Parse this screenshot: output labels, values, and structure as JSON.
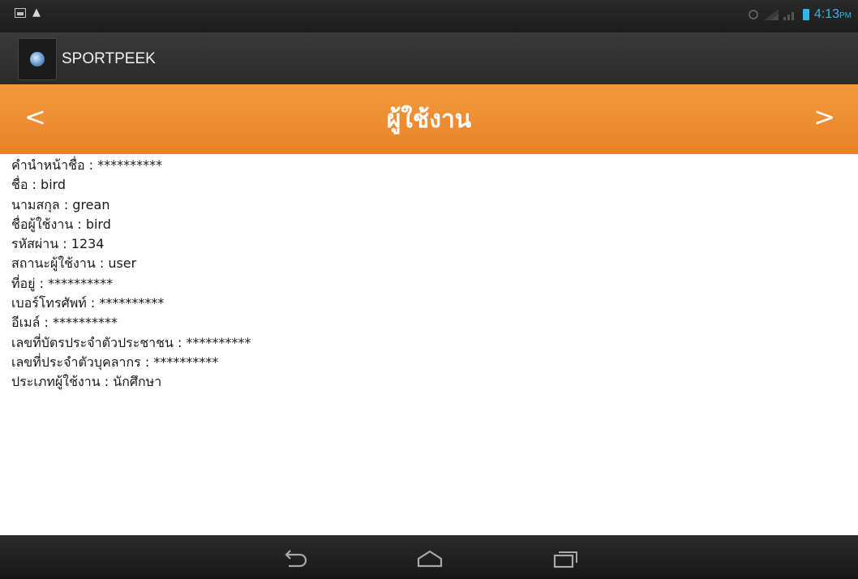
{
  "status_bar": {
    "time": "4:13",
    "ampm": "PM",
    "icons": [
      "picture-icon",
      "warning-icon",
      "alarm-icon",
      "signal-icon",
      "battery-icon"
    ]
  },
  "action_bar": {
    "app_name": "SPORTPEEK",
    "logo": "app-logo-icon"
  },
  "header": {
    "title": "ผู้ใช้งาน",
    "prev_label": "<",
    "next_label": ">",
    "color": "#ee8a2e"
  },
  "user_info": [
    "คำนำหน้าชื่อ : **********",
    "ชื่อ : bird",
    "นามสกุล : grean",
    "ชื่อผู้ใช้งาน : bird",
    "รหัสผ่าน : 1234",
    "สถานะผู้ใช้งาน : user",
    "ที่อยู่ : **********",
    "เบอร์โทรศัพท์ : **********",
    "อีเมล์ : **********",
    "เลขที่บัตรประจำตัวประชาชน : **********",
    "เลขที่ประจำตัวบุคลากร : **********",
    "ประเภทผู้ใช้งาน : นักศึกษา"
  ],
  "navigation_bar": {
    "keys": [
      "back-icon",
      "home-icon",
      "recent-apps-icon"
    ]
  }
}
